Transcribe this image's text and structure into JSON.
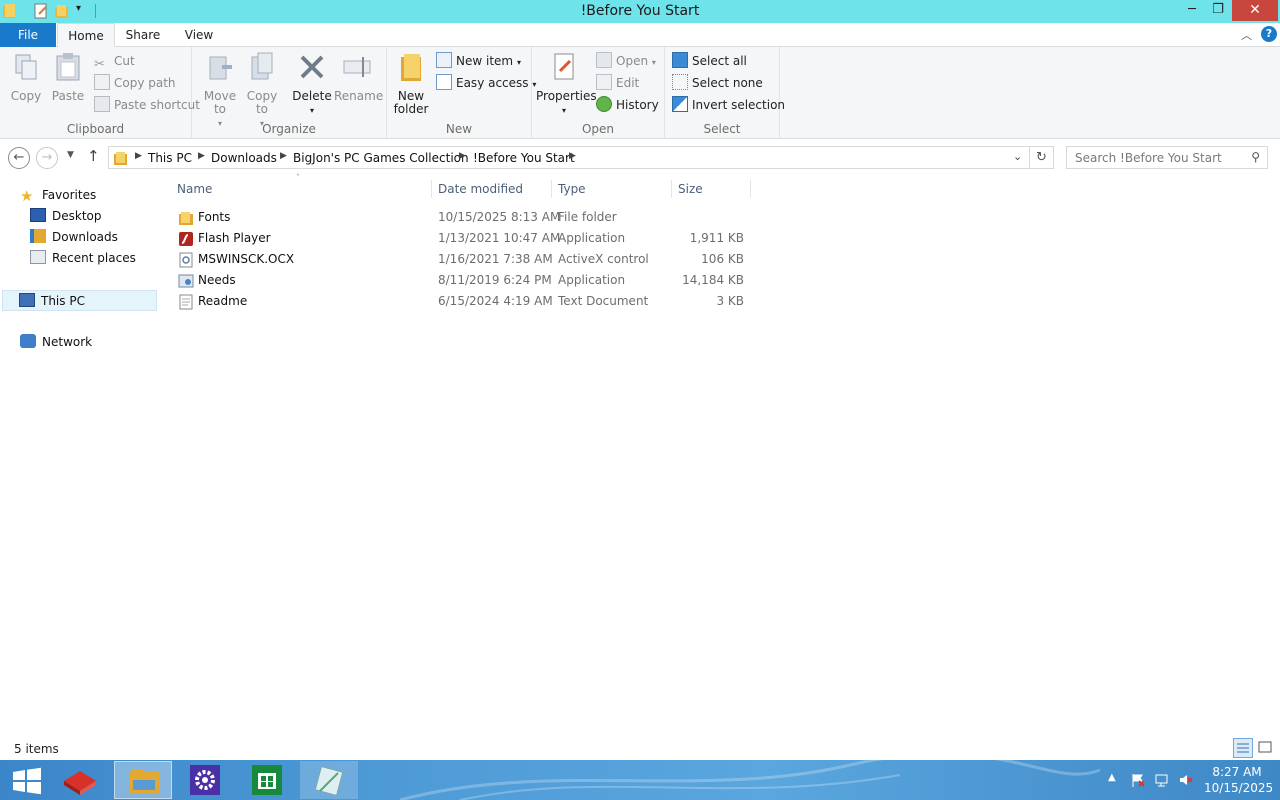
{
  "window": {
    "title": "!Before You Start"
  },
  "titlebar": {
    "minimize": "─",
    "restore": "❐",
    "close": "✕"
  },
  "tabs": [
    {
      "label": "File"
    },
    {
      "label": "Home"
    },
    {
      "label": "Share"
    },
    {
      "label": "View"
    }
  ],
  "ribbon": {
    "clipboard": {
      "label": "Clipboard",
      "copy": "Copy",
      "paste": "Paste",
      "cut": "Cut",
      "copy_path": "Copy path",
      "paste_shortcut": "Paste shortcut"
    },
    "organize": {
      "label": "Organize",
      "move_to": "Move\nto",
      "copy_to": "Copy\nto",
      "delete": "Delete",
      "rename": "Rename"
    },
    "new": {
      "label": "New",
      "new_folder": "New\nfolder",
      "new_item": "New item",
      "easy_access": "Easy access"
    },
    "open": {
      "label": "Open",
      "properties": "Properties",
      "open": "Open",
      "edit": "Edit",
      "history": "History"
    },
    "select": {
      "label": "Select",
      "select_all": "Select all",
      "select_none": "Select none",
      "invert_selection": "Invert selection"
    }
  },
  "address": {
    "crumbs": [
      "This PC",
      "Downloads",
      "BigJon's PC Games Collection",
      "!Before You Start"
    ],
    "search_placeholder": "Search !Before You Start"
  },
  "nav": {
    "favorites": "Favorites",
    "desktop": "Desktop",
    "downloads": "Downloads",
    "recent": "Recent places",
    "thispc": "This PC",
    "network": "Network"
  },
  "columns": {
    "name": "Name",
    "date": "Date modified",
    "type": "Type",
    "size": "Size"
  },
  "files": [
    {
      "name": "Fonts",
      "date": "10/15/2025 8:13 AM",
      "type": "File folder",
      "size": "",
      "icon": "folder-icon"
    },
    {
      "name": "Flash Player",
      "date": "1/13/2021 10:47 AM",
      "type": "Application",
      "size": "1,911 KB",
      "icon": "flash-player-icon"
    },
    {
      "name": "MSWINSCK.OCX",
      "date": "1/16/2021 7:38 AM",
      "type": "ActiveX control",
      "size": "106 KB",
      "icon": "activex-icon"
    },
    {
      "name": "Needs",
      "date": "8/11/2019 6:24 PM",
      "type": "Application",
      "size": "14,184 KB",
      "icon": "application-icon"
    },
    {
      "name": "Readme",
      "date": "6/15/2024 4:19 AM",
      "type": "Text Document",
      "size": "3 KB",
      "icon": "text-document-icon"
    }
  ],
  "status": {
    "items": "5 items"
  },
  "taskbar": {
    "time": "8:27 AM",
    "date": "10/15/2025"
  },
  "colors": {
    "titlebar": "#6ee3ea",
    "file_tab": "#1979ca",
    "close": "#c7463e",
    "taskbar": "#4d9ad6",
    "selection": "#e5f3fb"
  }
}
